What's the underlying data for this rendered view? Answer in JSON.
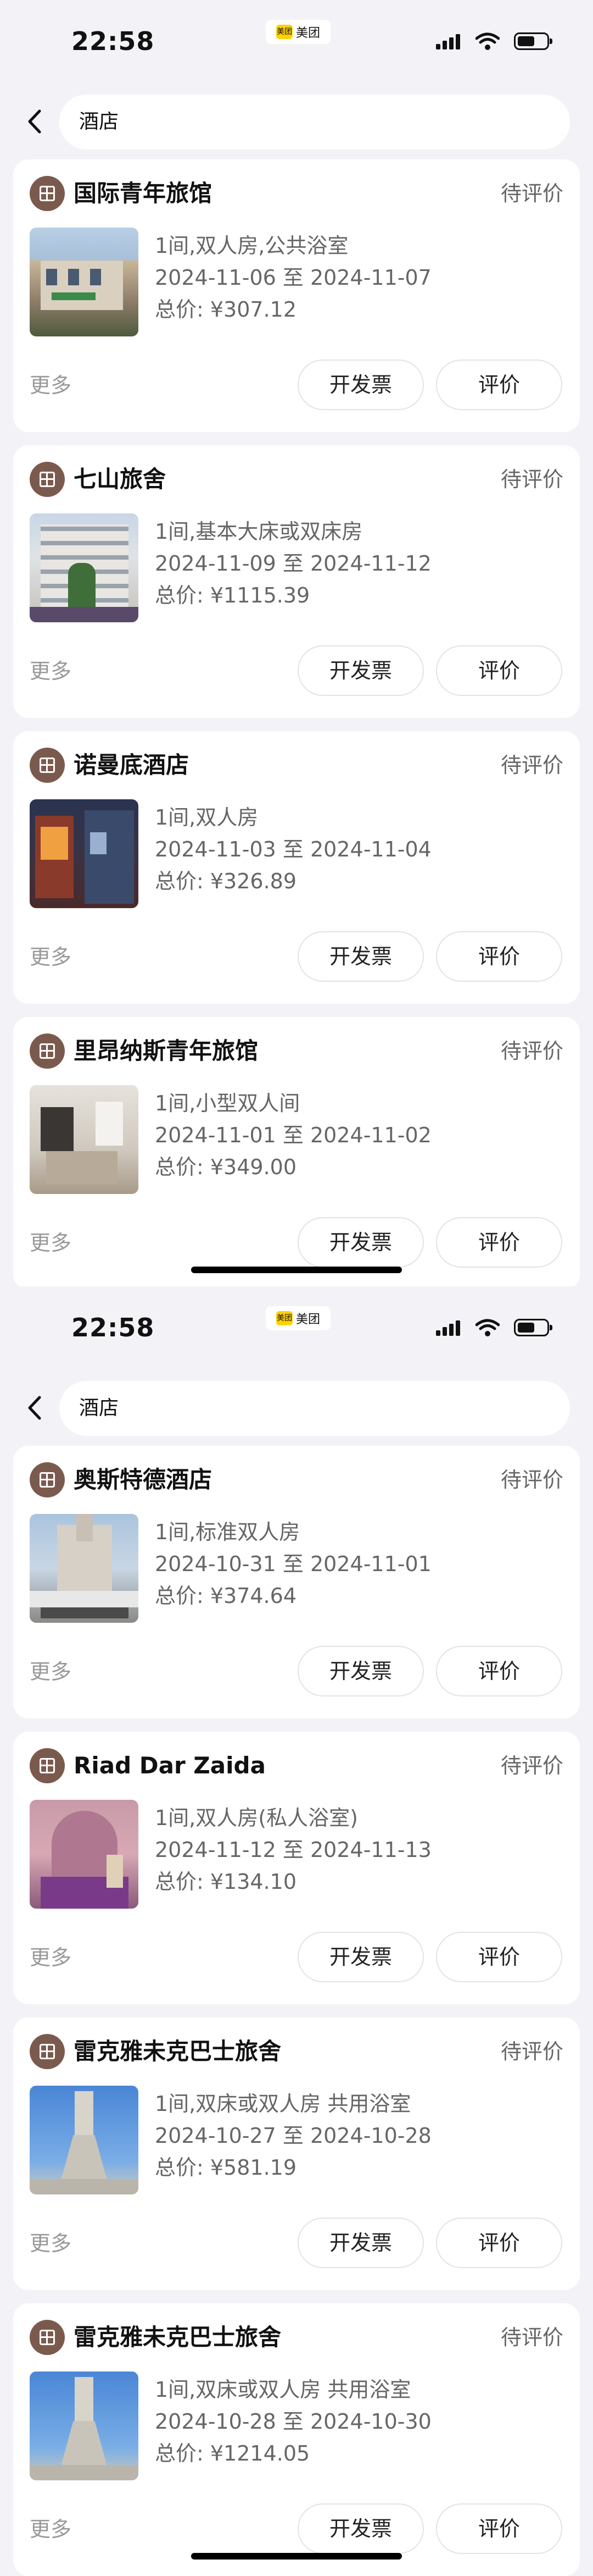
{
  "screens": [
    {
      "time": "22:58",
      "brand": "美团",
      "brand_logo": "美团",
      "search": "酒店",
      "orders": [
        {
          "name": "国际青年旅馆",
          "status": "待评价",
          "room": "1间,双人房,公共浴室",
          "dates": "2024-11-06 至 2024-11-07",
          "price": "总价: ¥307.12",
          "more": "更多",
          "invoice": "开发票",
          "review": "评价"
        },
        {
          "name": "七山旅舍",
          "status": "待评价",
          "room": "1间,基本大床或双床房",
          "dates": "2024-11-09 至 2024-11-12",
          "price": "总价: ¥1115.39",
          "more": "更多",
          "invoice": "开发票",
          "review": "评价"
        },
        {
          "name": "诺曼底酒店",
          "status": "待评价",
          "room": "1间,双人房",
          "dates": "2024-11-03 至 2024-11-04",
          "price": "总价: ¥326.89",
          "more": "更多",
          "invoice": "开发票",
          "review": "评价"
        },
        {
          "name": "里昂纳斯青年旅馆",
          "status": "待评价",
          "room": "1间,小型双人间",
          "dates": "2024-11-01 至 2024-11-02",
          "price": "总价: ¥349.00",
          "more": "更多",
          "invoice": "开发票",
          "review": "评价"
        }
      ]
    },
    {
      "time": "22:58",
      "brand": "美团",
      "brand_logo": "美团",
      "search": "酒店",
      "orders": [
        {
          "name": "奥斯特德酒店",
          "status": "待评价",
          "room": "1间,标准双人房",
          "dates": "2024-10-31 至 2024-11-01",
          "price": "总价: ¥374.64",
          "more": "更多",
          "invoice": "开发票",
          "review": "评价"
        },
        {
          "name": "Riad Dar Zaida",
          "status": "待评价",
          "room": "1间,双人房(私人浴室)",
          "dates": "2024-11-12 至 2024-11-13",
          "price": "总价: ¥134.10",
          "more": "更多",
          "invoice": "开发票",
          "review": "评价"
        },
        {
          "name": "雷克雅未克巴士旅舍",
          "status": "待评价",
          "room": "1间,双床或双人房 共用浴室",
          "dates": "2024-10-27 至 2024-10-28",
          "price": "总价: ¥581.19",
          "more": "更多",
          "invoice": "开发票",
          "review": "评价"
        },
        {
          "name": "雷克雅未克巴士旅舍",
          "status": "待评价",
          "room": "1间,双床或双人房 共用浴室",
          "dates": "2024-10-28 至 2024-10-30",
          "price": "总价: ¥1214.05",
          "more": "更多",
          "invoice": "开发票",
          "review": "评价"
        }
      ]
    }
  ],
  "colors": {
    "hotel_icon_bg": "#7b5a4e",
    "status_text": "#666666",
    "page_bg": "#f3f3f7",
    "brand_yellow": "#ffd100"
  },
  "icons": {
    "back": "chevron-left-icon",
    "hotel": "hotel-icon",
    "signal": "cellular-signal-icon",
    "wifi": "wifi-icon",
    "battery": "battery-icon"
  },
  "battery_level": 0.55
}
